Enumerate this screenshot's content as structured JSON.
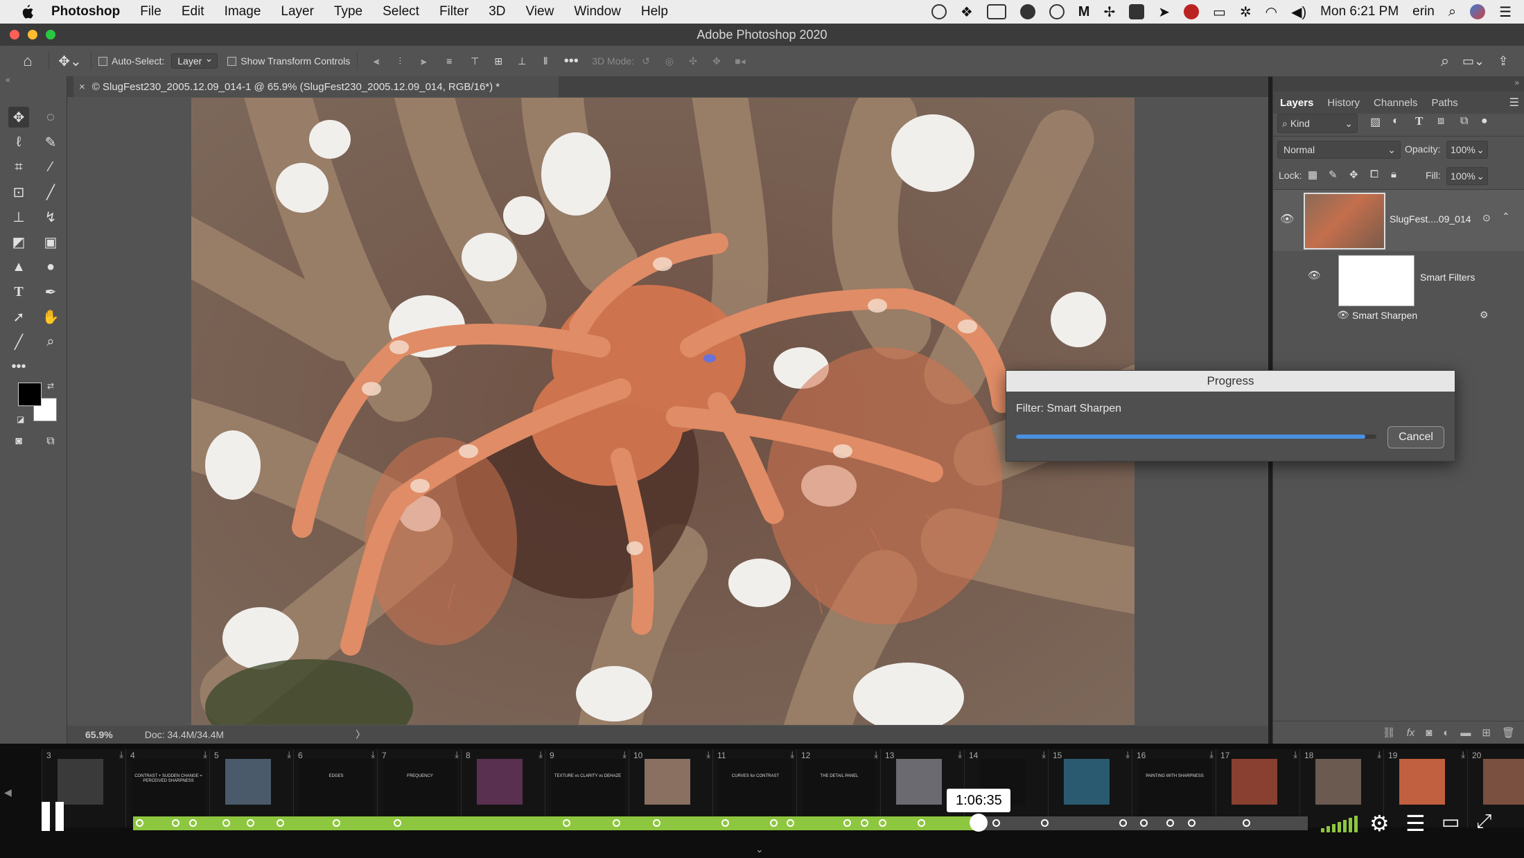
{
  "menubar": {
    "items": [
      "Photoshop",
      "File",
      "Edit",
      "Image",
      "Layer",
      "Type",
      "Select",
      "Filter",
      "3D",
      "View",
      "Window",
      "Help"
    ],
    "clock": "Mon 6:21 PM",
    "user": "erin"
  },
  "window": {
    "title": "Adobe Photoshop 2020"
  },
  "options": {
    "auto_select_label": "Auto-Select:",
    "auto_select_value": "Layer",
    "show_transform_label": "Show Transform Controls",
    "mode_3d_label": "3D Mode:"
  },
  "document": {
    "tab_title": "© SlugFest230_2005.12.09_014-1 @ 65.9% (SlugFest230_2005.12.09_014, RGB/16*) *",
    "zoom": "65.9%",
    "doc_size": "Doc: 34.4M/34.4M"
  },
  "panels": {
    "tabs": [
      "Layers",
      "History",
      "Channels",
      "Paths"
    ],
    "kind_label": "Kind",
    "blend_mode": "Normal",
    "opacity_label": "Opacity:",
    "opacity_value": "100%",
    "lock_label": "Lock:",
    "fill_label": "Fill:",
    "fill_value": "100%",
    "layer_name": "SlugFest....09_014",
    "smart_filters_label": "Smart Filters",
    "smart_sharpen_label": "Smart Sharpen"
  },
  "progress_dialog": {
    "title": "Progress",
    "message": "Filter: Smart Sharpen",
    "progress": 0.97,
    "cancel_label": "Cancel"
  },
  "player": {
    "timestamp": "1:06:35",
    "played_fraction": 0.72,
    "frames": [
      {
        "num": "3",
        "label": ""
      },
      {
        "num": "4",
        "label": "CONTRAST + SUDDEN CHANGE = PERCEIVED SHARPNESS"
      },
      {
        "num": "5",
        "label": ""
      },
      {
        "num": "6",
        "label": "EDGES"
      },
      {
        "num": "7",
        "label": "FREQUENCY"
      },
      {
        "num": "8",
        "label": ""
      },
      {
        "num": "9",
        "label": "TEXTURE vs CLARITY vs DEHAZE"
      },
      {
        "num": "10",
        "label": ""
      },
      {
        "num": "11",
        "label": "CURVES for CONTRAST"
      },
      {
        "num": "12",
        "label": "THE DETAIL PANEL"
      },
      {
        "num": "13",
        "label": ""
      },
      {
        "num": "14",
        "label": ""
      },
      {
        "num": "15",
        "label": ""
      },
      {
        "num": "16",
        "label": "PAINTING WITH SHARPNESS"
      },
      {
        "num": "17",
        "label": ""
      },
      {
        "num": "18",
        "label": ""
      },
      {
        "num": "19",
        "label": ""
      },
      {
        "num": "20",
        "label": ""
      }
    ],
    "colors": {
      "accent": "#8dc63f"
    }
  }
}
